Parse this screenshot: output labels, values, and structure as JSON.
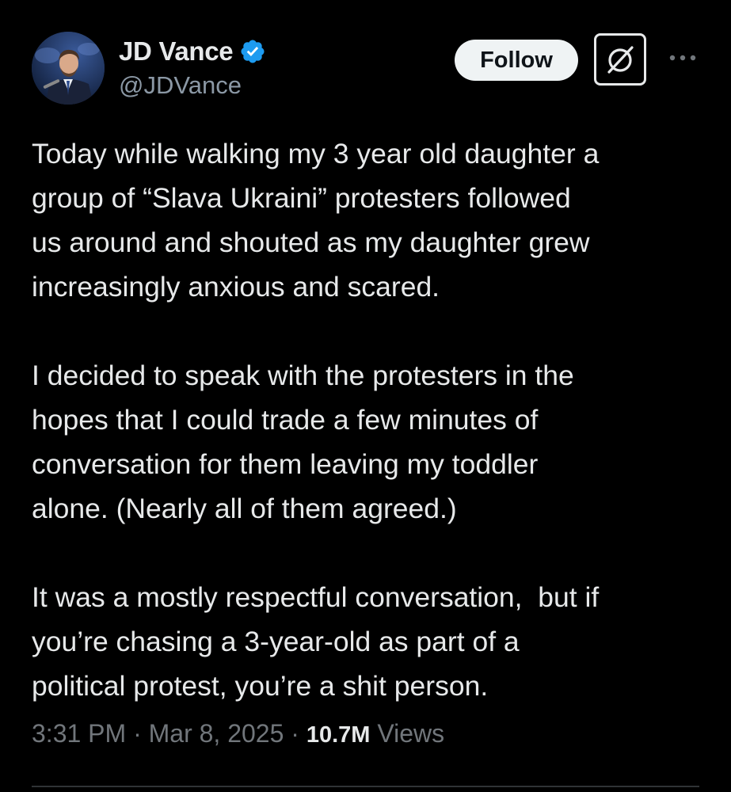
{
  "author": {
    "display_name": "JD Vance",
    "handle": "@JDVance",
    "verified_icon": "verified-badge-icon",
    "verified_color": "#1d9bf0"
  },
  "actions": {
    "follow_label": "Follow",
    "grok_icon": "grok-icon",
    "more_icon": "more-options-icon"
  },
  "tweet": {
    "paragraphs": [
      {
        "lines": [
          "Today while walking my 3 year old daughter a",
          "group of “Slava Ukraini” protesters followed",
          "us around and shouted as my daughter grew",
          "increasingly anxious and scared."
        ]
      },
      {
        "lines": [
          "I decided to speak with the protesters in the",
          "hopes that I could trade a few minutes of",
          "conversation for them leaving my toddler",
          "alone. (Nearly all of them agreed.)"
        ]
      },
      {
        "lines": [
          "It was a mostly respectful conversation,  but if",
          "you’re chasing a 3-year-old as part of a",
          "political protest, you’re a shit person."
        ]
      }
    ]
  },
  "meta": {
    "time": "3:31 PM",
    "separator": " · ",
    "date": "Mar 8, 2025",
    "views_count": "10.7M",
    "views_label": " Views"
  },
  "colors": {
    "background": "#000000",
    "text_primary": "#e7e9ea",
    "text_secondary": "#71767b",
    "follow_bg": "#eff3f4"
  }
}
